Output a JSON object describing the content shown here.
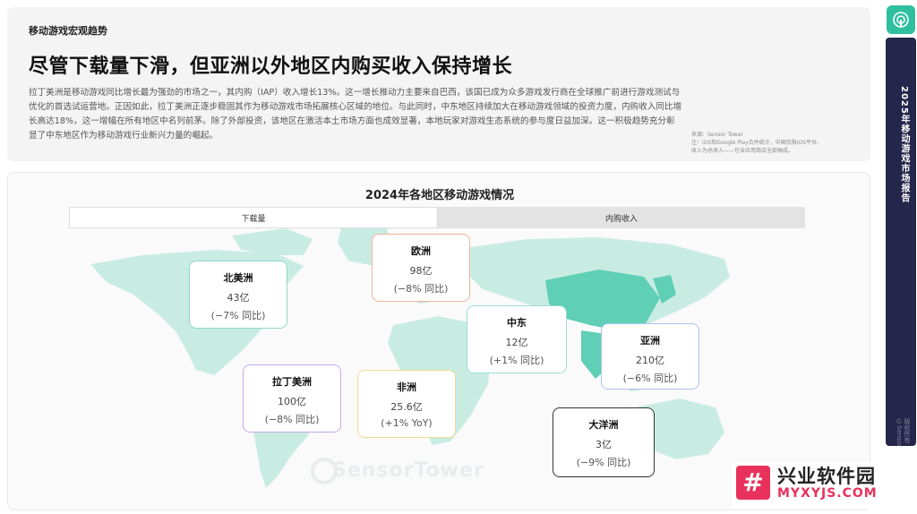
{
  "header": {
    "section_label": "移动游戏宏观趋势",
    "headline": "尽管下载量下滑，但亚洲以外地区内购买收入保持增长",
    "body": "拉丁美洲是移动游戏同比增长最为强劲的市场之一，其内购（IAP）收入增长13%。这一增长推动力主要来自巴西，该国已成为众多游戏发行商在全球推广前进行游戏测试与优化的首选试运营地。正因如此，拉丁美洲正逐步稳固其作为移动游戏市场拓展核心区域的地位。与此同时，中东地区持续加大在移动游戏领域的投资力度，内购收入同比增长高达18%，这一增幅在所有地区中名列前茅。除了外部投资，该地区在激活本土市场方面也成效显著，本地玩家对游戏生态系统的参与度日益加深。这一积极趋势充分彰显了中东地区作为移动游戏行业新兴力量的崛起。",
    "source_line1": "来源：Sensor Tower",
    "source_line2": "注：iOS和Google Play合并统计，中国仅限iOS平台。",
    "source_line3": "收入为总收入——包含应用商店全部抽成。"
  },
  "sidebar": {
    "report_title": "2025年移动游戏市场报告",
    "copyright": "版权所有©Sensor",
    "logo_icon": "sensor-tower-icon"
  },
  "map": {
    "title": "2024年各地区移动游戏情况",
    "tabs": [
      {
        "label": "下载量",
        "active": true
      },
      {
        "label": "内购收入",
        "active": false
      }
    ],
    "watermark": "SensorTower",
    "land_color": "#c9ece2",
    "highlight_color": "#5fcfb6",
    "regions": [
      {
        "name": "北美洲",
        "value": "43亿",
        "change": "(−7% 同比)",
        "border": "#8fd8c8"
      },
      {
        "name": "欧洲",
        "value": "98亿",
        "change": "(−8% 同比)",
        "border": "#f2b49b"
      },
      {
        "name": "中东",
        "value": "12亿",
        "change": "(+1% 同比)",
        "border": "#9bdcd0"
      },
      {
        "name": "亚洲",
        "value": "210亿",
        "change": "(−6% 同比)",
        "border": "#a9c2ec"
      },
      {
        "name": "拉丁美洲",
        "value": "100亿",
        "change": "(−8% 同比)",
        "border": "#c9a6ec"
      },
      {
        "name": "非洲",
        "value": "25.6亿",
        "change": "(+1% YoY)",
        "border": "#f2dc8c"
      },
      {
        "name": "大洋洲",
        "value": "3亿",
        "change": "(−9% 同比)",
        "border": "#333333"
      }
    ]
  },
  "corner_logo": {
    "mark": "#",
    "name": "兴业软件园",
    "url": "MYXYJS.COM"
  }
}
